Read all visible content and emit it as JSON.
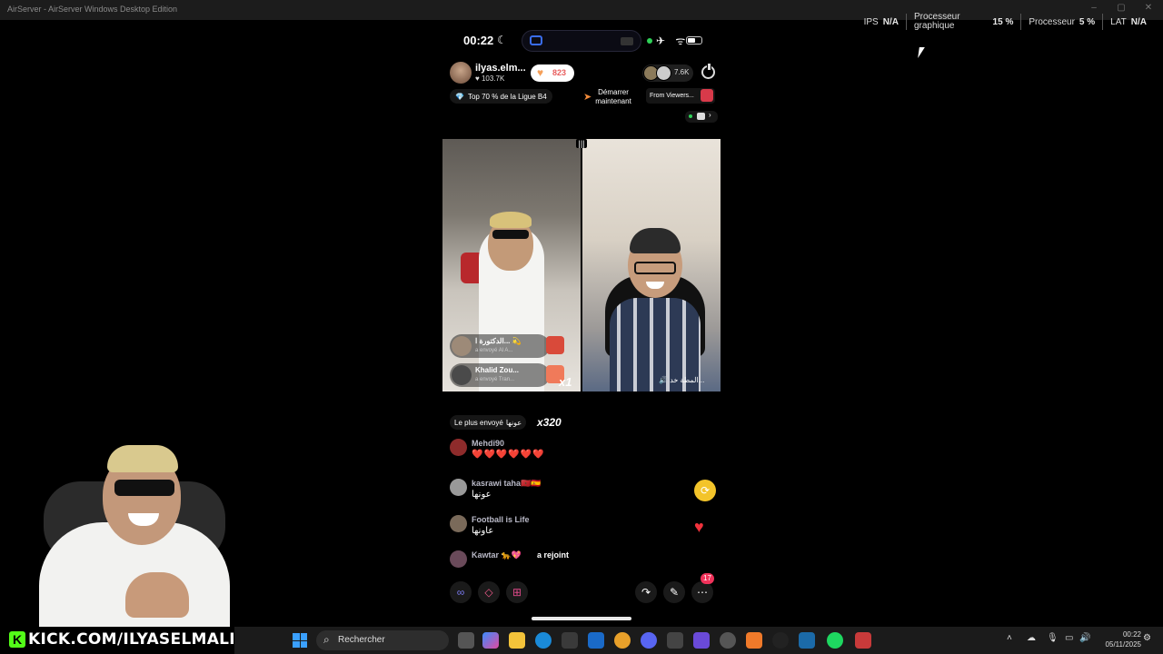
{
  "window": {
    "title": "AirServer - AirServer Windows Desktop Edition"
  },
  "overlay_stats": {
    "ips_label": "IPS",
    "ips_value": "N/A",
    "gpu_label_line1": "Processeur",
    "gpu_label_line2": "graphique",
    "gpu_value": "15 %",
    "cpu_label": "Processeur",
    "cpu_value": "5 %",
    "lat_label": "LAT",
    "lat_value": "N/A"
  },
  "phone": {
    "status_time": "00:22",
    "host": {
      "name": "ilyas.elm...",
      "likes": "103.7K",
      "heart_count": "823"
    },
    "viewer_count": "7.6K",
    "league_text": "Top 70 % de la Ligue B4",
    "start_line1": "Démarrer",
    "start_line2": "maintenant",
    "from_viewers": "From Viewers...",
    "gift_notes": [
      {
        "name": "الدكتورة ا... 💫",
        "sub": "a envoyé  Al A..."
      },
      {
        "name": "Khalid Zou...",
        "sub": "a envoyé  Tran..."
      }
    ],
    "multiplier": "x1",
    "right_video_label": "المطة خد...",
    "most_sent_label": "Le plus envoyé",
    "most_sent_item": "عونها",
    "most_sent_count": "x320",
    "chat": [
      {
        "user": "Mehdi90",
        "text": "❤️❤️❤️❤️❤️❤️"
      },
      {
        "user": "kasrawi taha🇲🇦🇪🇸",
        "text": "عونها"
      },
      {
        "user": "Football is Life",
        "text": "عاونها"
      }
    ],
    "join_user": "Kawtar 🐆💖",
    "join_text": "a rejoint",
    "notif_badge": "17"
  },
  "stream_overlay": {
    "kick_url": "KICK.COM/ILYASELMALIKI"
  },
  "taskbar": {
    "search_placeholder": "Rechercher",
    "clock_time": "00:22",
    "clock_date": "05/11/2025"
  }
}
